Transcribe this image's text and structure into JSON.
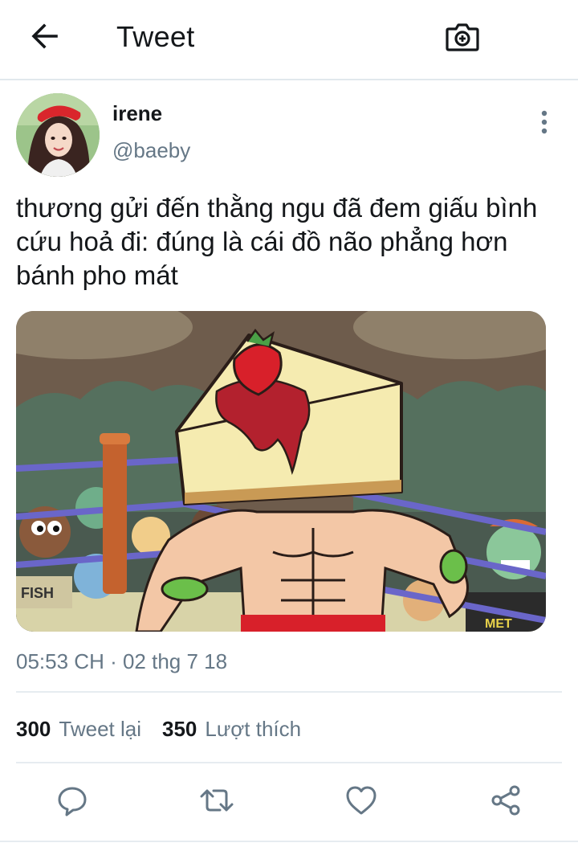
{
  "header": {
    "title": "Tweet",
    "back_icon": "arrow-left-icon",
    "camera_icon": "camera-plus-icon"
  },
  "tweet": {
    "author": {
      "display_name": "irene",
      "handle": "@baeby"
    },
    "text": "thương gửi đến thằng ngu đã đem giấu bình cứu hoả đi: đúng là cái đồ não phẳng hơn bánh pho mát",
    "media": {
      "description_icon": "cheesecake-boxer-cartoon",
      "sign_text": "FISH",
      "shirt_text": "MET"
    },
    "timestamp": "05:53 CH · 02 thg 7 18",
    "stats": {
      "retweets_count": "300",
      "retweets_label": "Tweet lại",
      "likes_count": "350",
      "likes_label": "Lượt thích"
    }
  },
  "actions": [
    "reply-icon",
    "retweet-icon",
    "like-icon",
    "share-icon"
  ],
  "colors": {
    "text": "#14171a",
    "secondary": "#657786",
    "divider": "#e6ecf0"
  }
}
